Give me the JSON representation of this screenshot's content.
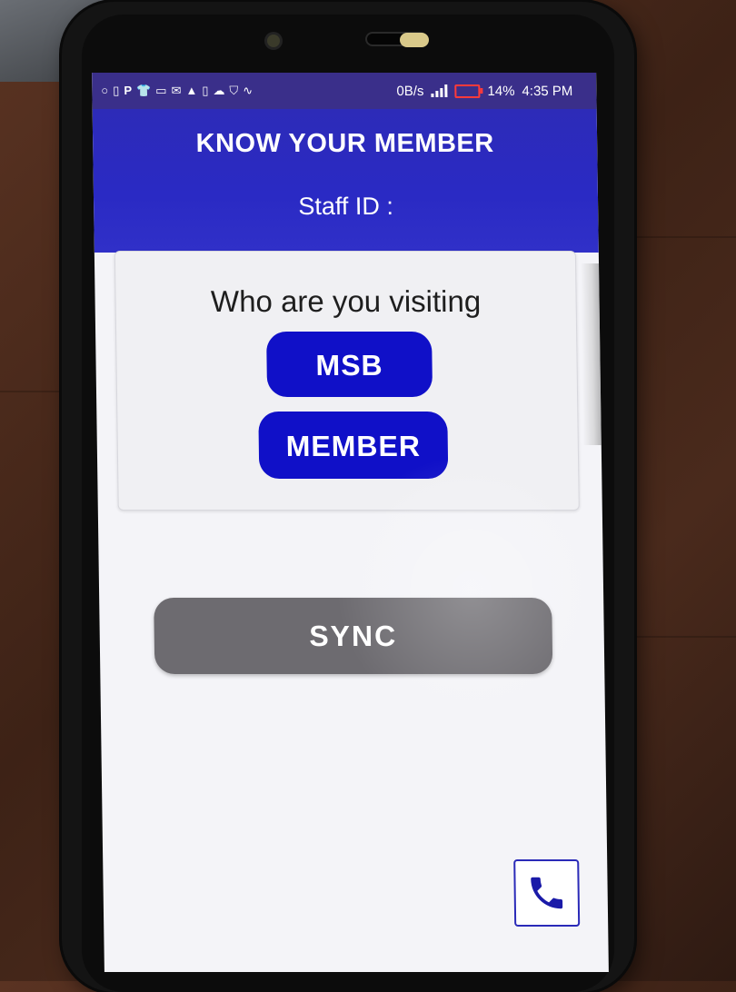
{
  "status_bar": {
    "icons": [
      "circle-icon",
      "sim-icon",
      "p-icon",
      "tshirt-icon",
      "image-icon",
      "mail-icon",
      "warning-icon",
      "phone-icon",
      "cloud-upload-icon",
      "shield-check-icon",
      "pulse-icon"
    ],
    "network_speed": "0B/s",
    "battery": "14%",
    "time": "4:35 PM"
  },
  "header": {
    "title": "KNOW YOUR MEMBER",
    "staff_label": "Staff ID :"
  },
  "visit_card": {
    "prompt": "Who are you visiting",
    "msb_label": "MSB",
    "member_label": "MEMBER"
  },
  "sync_label": "SYNC",
  "call_button": {
    "icon": "phone-icon"
  },
  "colors": {
    "header": "#2a2ac4",
    "primary_button": "#1010c8",
    "sync_button": "#6d6b70",
    "background": "#f4f4f8"
  }
}
